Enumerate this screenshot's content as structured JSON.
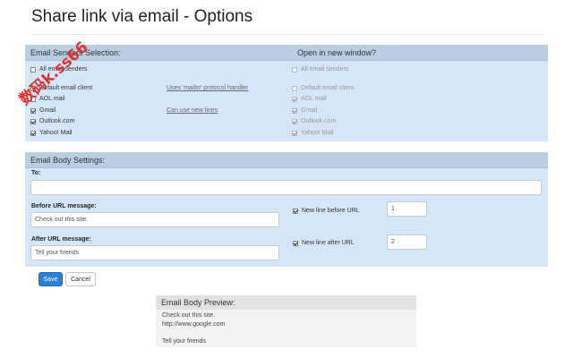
{
  "page": {
    "title": "Share link via email - Options"
  },
  "senders": {
    "header_left": "Email Senders Selection:",
    "header_right": "Open in new window?",
    "left_items": [
      {
        "label": "All email senders",
        "checked": false
      },
      {
        "label": "Default email client",
        "checked": false
      },
      {
        "label": "AOL mail",
        "checked": false
      },
      {
        "label": "Gmail",
        "checked": true
      },
      {
        "label": "Outlook.com",
        "checked": true
      },
      {
        "label": "Yahoo! Mail",
        "checked": true
      }
    ],
    "right_items": [
      {
        "label": "All email senders",
        "checked": false
      },
      {
        "label": "Default email client",
        "checked": false
      },
      {
        "label": "AOL mail",
        "checked": true
      },
      {
        "label": "Gmail",
        "checked": true
      },
      {
        "label": "Outlook.com",
        "checked": true
      },
      {
        "label": "Yahoo! Mail",
        "checked": true
      }
    ],
    "mailto_note": "Uses 'mailto' protocol handler",
    "newlines_note": "Can use new lines"
  },
  "body_settings": {
    "header": "Email Body Settings:",
    "to_label": "To:",
    "to_value": "",
    "before_label": "Before URL message:",
    "before_value": "Check out this site.",
    "after_label": "After URL message:",
    "after_value": "Tell your firends",
    "newline_before_label": "New line before URL",
    "newline_before_checked": true,
    "newline_before_count": "1",
    "newline_after_label": "New line after URL",
    "newline_after_checked": true,
    "newline_after_count": "2"
  },
  "actions": {
    "save_label": "Save",
    "cancel_label": "Cancel"
  },
  "preview": {
    "header": "Email Body Preview:",
    "line1": "Check out this site.",
    "line2": "http://www.google.com",
    "line3": "Tell your firends"
  },
  "watermark": {
    "text": "数码k.ss66"
  }
}
